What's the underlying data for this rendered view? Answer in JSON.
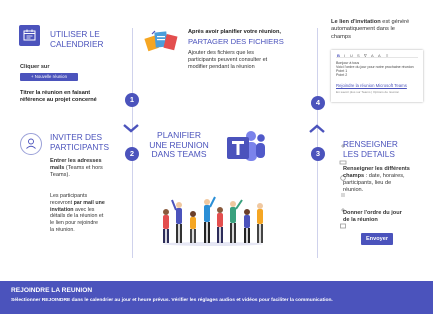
{
  "s1": {
    "title_l1": "UTILISER LE",
    "title_l2": "CALENDRIER",
    "click_label": "Cliquer sur",
    "button_label": "+ Nouvelle réunion",
    "desc_l1": "Titrer la réunion en faisant",
    "desc_l2": "référence au projet concerné",
    "num": "1"
  },
  "s2": {
    "title_l1": "INVITER DES",
    "title_l2": "PARTICIPANTS",
    "p1_l1": "Entrer les adresses",
    "p1_l2": "mails",
    "p1_l2b": " (Teams et hors",
    "p1_l3": "Teams).",
    "p2_l1": "Les participants",
    "p2_l2a": "recevront ",
    "p2_l2b": "par mail une",
    "p2_l3a": "invitation",
    "p2_l3b": " avec les",
    "p2_l4": "détails de la réunion et",
    "p2_l5": "le lien pour rejoindre",
    "p2_l6": "la réunion.",
    "num": "2"
  },
  "s3": {
    "intro_l1": "Après avoir planifier votre réunion,",
    "title": "PARTAGER DES FICHIERS",
    "body_l1": "Ajouter des fichiers que les",
    "body_l2": "participants peuvent consulter et",
    "body_l3": "modifier pendant la réunion"
  },
  "s4": {
    "p_l1a": "Le lien d'",
    "p_l1b": "invitation",
    "p_l1c": " est généré",
    "p_l2": "automatiquement dans le",
    "p_l3": "champs",
    "doc_link": "Rejoindre la réunion Microsoft Teams",
    "doc_line1": "Bonjour à tous",
    "doc_line2": "Voici l'ordre du jour pour notre prochaine réunion",
    "doc_line3": "Point 1",
    "doc_line4": "Point 2",
    "doc_small": "En savoir plus sur Teams | Options de réunion",
    "num": "4"
  },
  "s5": {
    "title_l1": "RENSEIGNER",
    "title_l2": "LES DETAILS",
    "p1_l1": "Renseigner les différents",
    "p1_l2a": "champs",
    "p1_l2b": " : date, horaires,",
    "p1_l3": "participants, lieu de",
    "p1_l4": "réunion.",
    "p2_l1": "Donner l'ordre du jour",
    "p2_l2": "de la réunion",
    "button": "Envoyer",
    "num": "3"
  },
  "center": {
    "l1": "PLANIFIER",
    "l2": "UNE REUNION",
    "l3": "DANS TEAMS"
  },
  "footer": {
    "title": "REJOINDRE LA REUNION",
    "text": "Sélectionner REJOINDRE dans le calendrier au jour et heure prévus. Vérifier les réglages audios et vidéos pour faciliter la communication."
  },
  "colors": {
    "accent": "#4b53bc",
    "footer_bg": "#4b53bc"
  },
  "icons": [
    "calendar-icon",
    "people-icon",
    "files-icon",
    "teams-logo-icon",
    "chevron-down-icon",
    "chevron-up-icon",
    "people-group-illustration"
  ]
}
